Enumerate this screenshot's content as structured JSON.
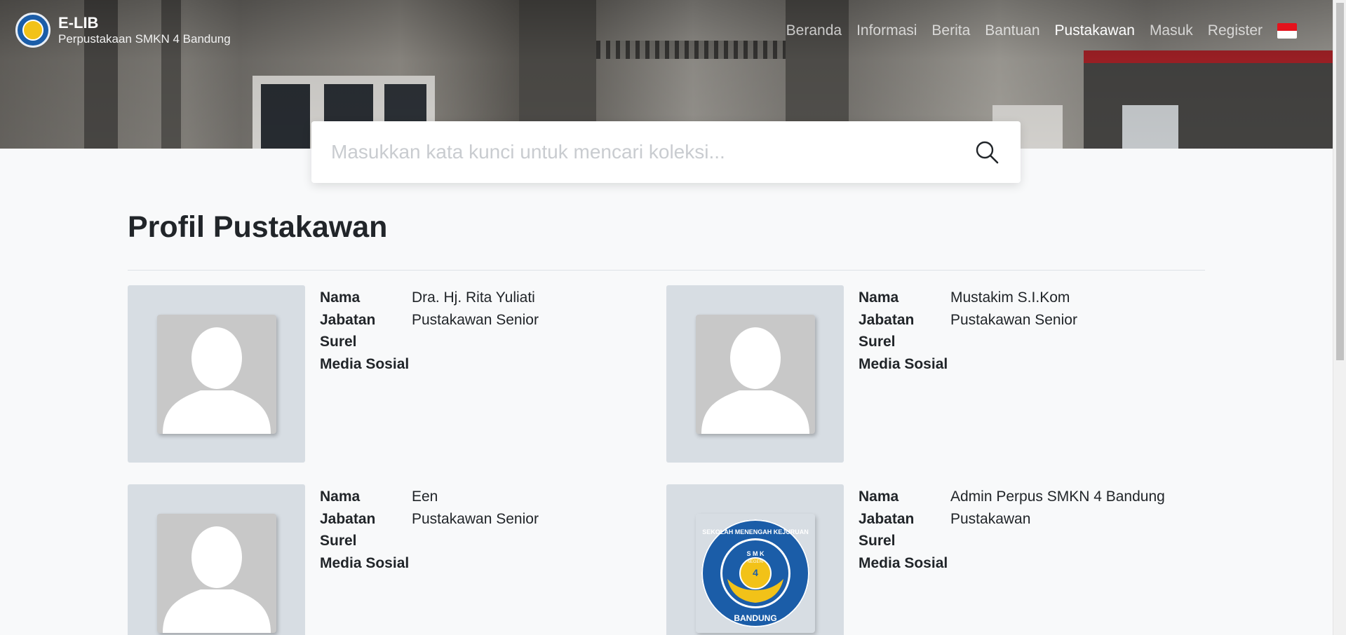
{
  "brand": {
    "title": "E-LIB",
    "subtitle": "Perpustakaan SMKN 4 Bandung",
    "logo_icon": "school-seal-icon"
  },
  "nav": {
    "items": [
      {
        "label": "Beranda",
        "active": false
      },
      {
        "label": "Informasi",
        "active": false
      },
      {
        "label": "Berita",
        "active": false
      },
      {
        "label": "Bantuan",
        "active": false
      },
      {
        "label": "Pustakawan",
        "active": true
      },
      {
        "label": "Masuk",
        "active": false
      },
      {
        "label": "Register",
        "active": false
      }
    ],
    "language_flag": "indonesia-flag-icon"
  },
  "search": {
    "value": "",
    "placeholder": "Masukkan kata kunci untuk mencari koleksi..."
  },
  "page": {
    "title": "Profil Pustakawan"
  },
  "field_labels": {
    "name": "Nama",
    "position": "Jabatan",
    "email": "Surel",
    "social": "Media Sosial"
  },
  "librarians": [
    {
      "name": "Dra. Hj. Rita Yuliati",
      "position": "Pustakawan Senior",
      "email": "",
      "social": "",
      "photo": "placeholder-avatar"
    },
    {
      "name": "Mustakim S.I.Kom",
      "position": "Pustakawan Senior",
      "email": "",
      "social": "",
      "photo": "placeholder-avatar"
    },
    {
      "name": "Een",
      "position": "Pustakawan Senior",
      "email": "",
      "social": "",
      "photo": "placeholder-avatar"
    },
    {
      "name": "Admin Perpus SMKN 4 Bandung",
      "position": "Pustakawan",
      "email": "",
      "social": "",
      "photo": "school-logo"
    }
  ],
  "school_logo": {
    "ring_text": "SEKOLAH MENENGAH KEJURUAN",
    "center_top": "S M K",
    "center_sub": "NEGERI",
    "number": "4",
    "city": "BANDUNG"
  },
  "colors": {
    "accent_blue": "#1b5da8",
    "flag_red": "#e5121c"
  }
}
